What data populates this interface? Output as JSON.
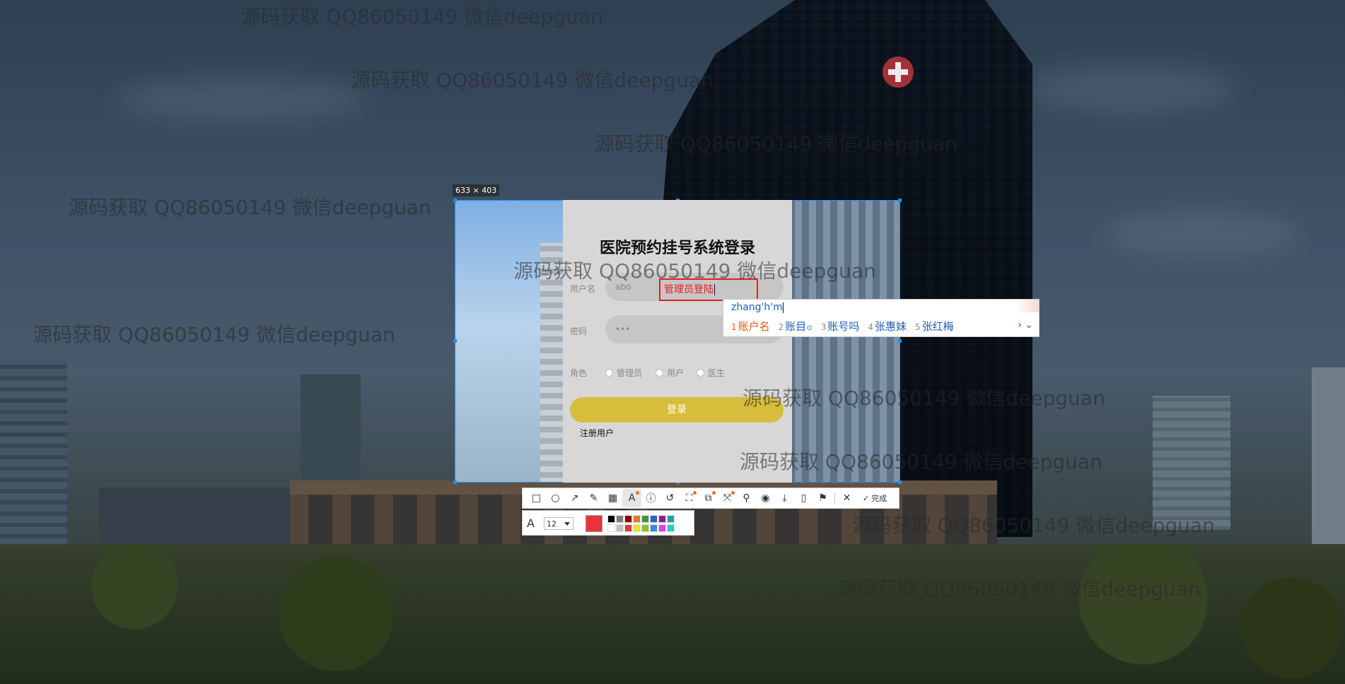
{
  "selection": {
    "size_label": "633 × 403"
  },
  "login": {
    "title": "医院预约挂号系统登录",
    "username_label": "用户名",
    "username_value": "abo",
    "password_label": "密码",
    "password_value": "•••",
    "role_label": "角色",
    "roles": [
      "管理员",
      "用户",
      "医生"
    ],
    "login_button": "登录",
    "register_link": "注册用户"
  },
  "annotation": {
    "text": "管理员登陆",
    "color": "#e02020"
  },
  "ime": {
    "pinyin": "zhang'h'm",
    "candidates": [
      {
        "n": "1",
        "text": "账户名"
      },
      {
        "n": "2",
        "text": "账目"
      },
      {
        "n": "3",
        "text": "账号吗"
      },
      {
        "n": "4",
        "text": "张惠妹"
      },
      {
        "n": "5",
        "text": "张红梅"
      }
    ],
    "nav": "› ⌄"
  },
  "toolbar": {
    "tools": [
      {
        "name": "rectangle-tool",
        "glyph": "□"
      },
      {
        "name": "ellipse-tool",
        "glyph": "○"
      },
      {
        "name": "arrow-tool",
        "glyph": "↗"
      },
      {
        "name": "pen-tool",
        "glyph": "✎"
      },
      {
        "name": "mosaic-tool",
        "glyph": "▦"
      },
      {
        "name": "text-tool",
        "glyph": "A",
        "active": true,
        "dot": true
      },
      {
        "name": "sequence-tool",
        "glyph": "ⓘ"
      },
      {
        "name": "undo-tool",
        "glyph": "↺"
      },
      {
        "name": "ocr-tool",
        "glyph": "⛶",
        "dot": true
      },
      {
        "name": "translate-tool",
        "glyph": "⧉",
        "dot": true
      },
      {
        "name": "long-capture-tool",
        "glyph": "⤧",
        "dot": true
      },
      {
        "name": "pin-tool",
        "glyph": "⚲"
      },
      {
        "name": "record-tool",
        "glyph": "◉"
      },
      {
        "name": "save-tool",
        "glyph": "⤓"
      },
      {
        "name": "phone-tool",
        "glyph": "▯"
      },
      {
        "name": "bookmark-tool",
        "glyph": "⚑"
      },
      {
        "name": "close-tool",
        "glyph": "✕"
      }
    ],
    "done_label": "完成"
  },
  "text_options": {
    "font_size": "12",
    "current_color": "#e8333a",
    "palette": [
      "#000000",
      "#808080",
      "#8b0000",
      "#e07a30",
      "#3a9a3a",
      "#3060c0",
      "#8a2090",
      "#20a0a0",
      "#ffffff",
      "#c0c0c0",
      "#e8333a",
      "#f0e020",
      "#90c020",
      "#3090e0",
      "#e040e0",
      "#20d0c0"
    ]
  },
  "watermarks": [
    "源码获取 QQ86050149 微信deepguan",
    "源码获取 QQ86050149 微信deepguan",
    "源码获取 QQ86050149 微信deepguan",
    "源码获取 QQ86050149 微信deepguan",
    "源码获取 QQ86050149 微信deepguan",
    "源码获取 QQ86050149 微信deepguan",
    "源码获取 QQ86050149 微信deepguan",
    "源码获取 QQ86050149 微信deepguan",
    "源码获取 QQ86050149 微信deepguan",
    "源码获取 QQ86050149 微信deepguan"
  ]
}
